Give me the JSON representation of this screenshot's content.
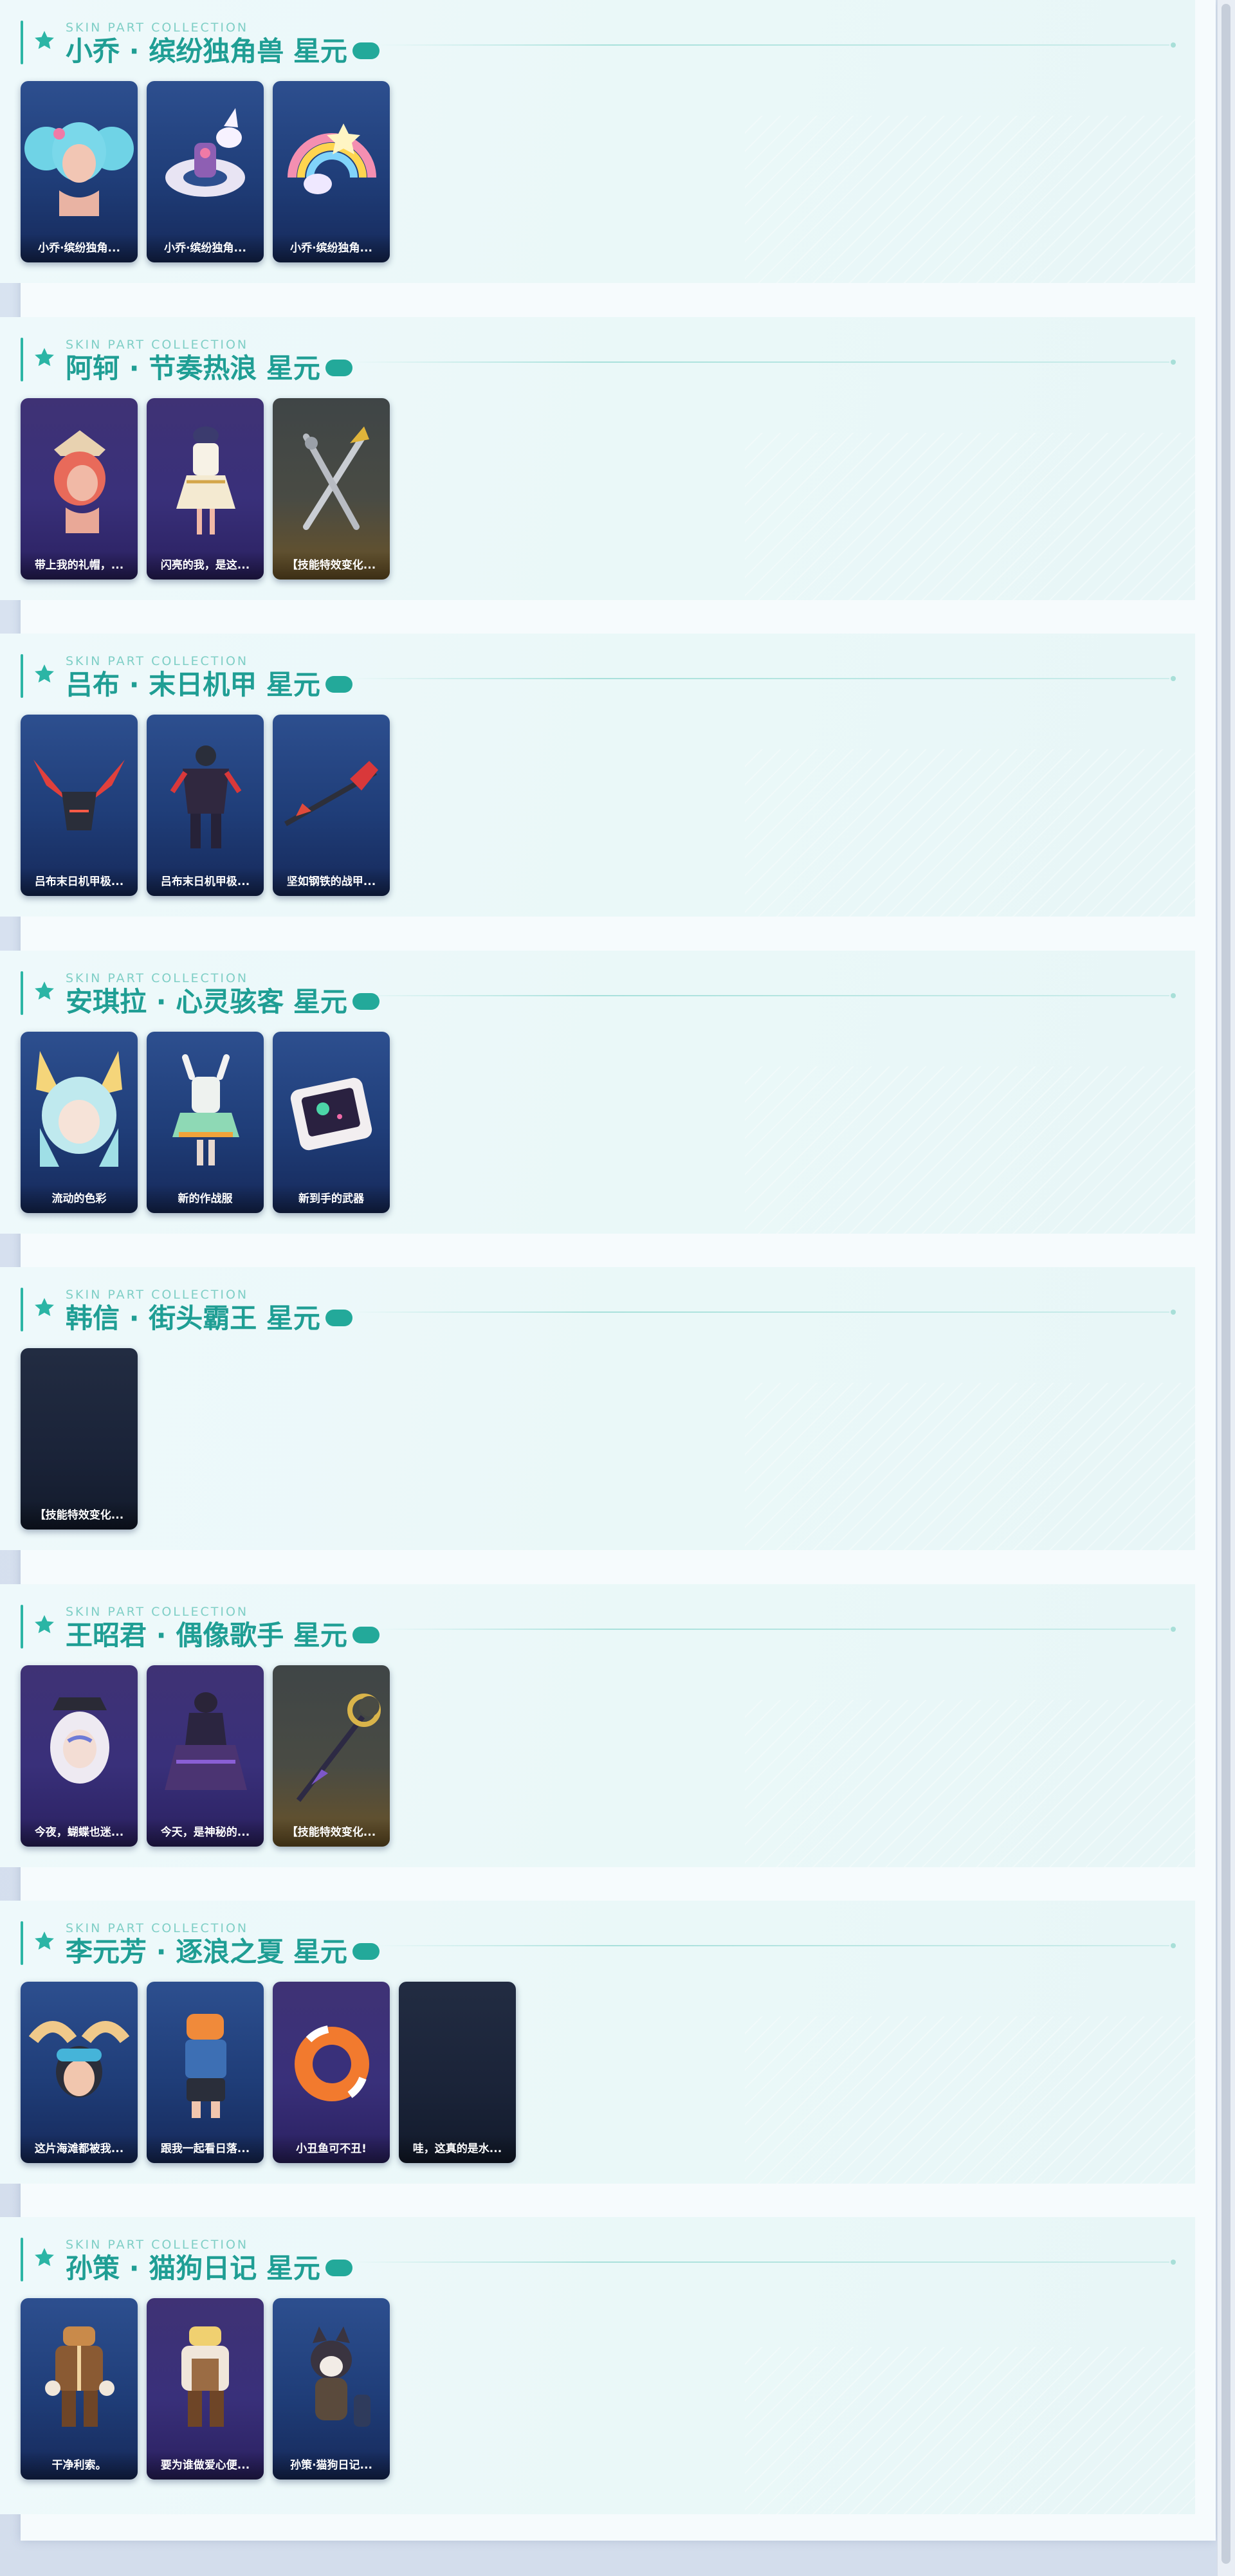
{
  "kicker": "SKIN PART COLLECTION",
  "sections": [
    {
      "title": "小乔 · 缤纷独角兽 星元",
      "cards": [
        {
          "label": "小乔·缤纷独角...",
          "theme": "blue",
          "art": "pink-twin-tail-hair"
        },
        {
          "label": "小乔·缤纷独角...",
          "theme": "blue",
          "art": "unicorn-float-outfit"
        },
        {
          "label": "小乔·缤纷独角...",
          "theme": "blue",
          "art": "rainbow-fan-weapon"
        }
      ]
    },
    {
      "title": "阿轲 · 节奏热浪 星元",
      "cards": [
        {
          "label": "带上我的礼帽，...",
          "theme": "purple",
          "art": "red-hair-hat"
        },
        {
          "label": "闪亮的我，是这...",
          "theme": "purple",
          "art": "stage-outfit"
        },
        {
          "label": "【技能特效变化...",
          "theme": "olive",
          "art": "crossed-blades"
        }
      ]
    },
    {
      "title": "吕布 · 末日机甲 星元",
      "cards": [
        {
          "label": "吕布末日机甲极...",
          "theme": "blue",
          "art": "mecha-helmet"
        },
        {
          "label": "吕布末日机甲极...",
          "theme": "blue",
          "art": "mecha-armor"
        },
        {
          "label": "坚如钢铁的战甲...",
          "theme": "blue",
          "art": "mecha-halberd"
        }
      ]
    },
    {
      "title": "安琪拉 · 心灵骇客 星元",
      "cards": [
        {
          "label": "流动的色彩",
          "theme": "blue",
          "art": "cyan-hair-bunny-ears"
        },
        {
          "label": "新的作战服",
          "theme": "blue",
          "art": "hacker-outfit"
        },
        {
          "label": "新到手的武器",
          "theme": "blue",
          "art": "handheld-console"
        }
      ]
    },
    {
      "title": "韩信 · 街头霸王 星元",
      "cards": [
        {
          "label": "【技能特效变化...",
          "theme": "dark",
          "art": "empty"
        }
      ]
    },
    {
      "title": "王昭君 · 偶像歌手 星元",
      "cards": [
        {
          "label": "今夜，蝴蝶也迷...",
          "theme": "purple",
          "art": "white-hair-cap"
        },
        {
          "label": "今天，是神秘的...",
          "theme": "purple",
          "art": "dark-idol-dress"
        },
        {
          "label": "【技能特效变化...",
          "theme": "olive",
          "art": "moon-staff"
        }
      ]
    },
    {
      "title": "李元芳 · 逐浪之夏 星元",
      "cards": [
        {
          "label": "这片海滩都被我...",
          "theme": "blue",
          "art": "goggles-head"
        },
        {
          "label": "跟我一起看日落...",
          "theme": "blue",
          "art": "beach-outfit"
        },
        {
          "label": "小丑鱼可不丑!",
          "theme": "purple",
          "art": "clownfish-float"
        },
        {
          "label": "哇，这真的是水...",
          "theme": "dark",
          "art": "empty"
        }
      ]
    },
    {
      "title": "孙策 · 猫狗日记 星元",
      "cards": [
        {
          "label": "干净利索。",
          "theme": "blue",
          "art": "brown-jacket-outfit"
        },
        {
          "label": "要为谁做爱心便...",
          "theme": "purple",
          "art": "apron-outfit"
        },
        {
          "label": "孙策·猫狗日记...",
          "theme": "blue",
          "art": "dog-companion"
        }
      ]
    }
  ]
}
